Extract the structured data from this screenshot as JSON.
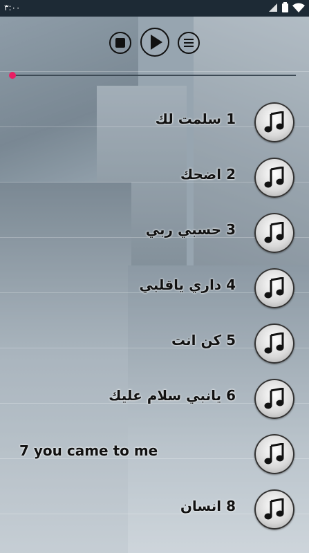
{
  "status_bar": {
    "time": "٣:٠٠"
  },
  "player": {
    "stop_icon": "stop-icon",
    "play_icon": "play-icon",
    "menu_icon": "menu-icon",
    "progress_fraction": 0.0
  },
  "songs": [
    {
      "label": "1 سلمت لك",
      "icon": "music-note-icon"
    },
    {
      "label": "2 اضحك",
      "icon": "music-note-icon"
    },
    {
      "label": "3 حسبي ربي",
      "icon": "music-note-icon"
    },
    {
      "label": "4 داري ياقلبي",
      "icon": "music-note-icon"
    },
    {
      "label": "5 كن انت",
      "icon": "music-note-icon"
    },
    {
      "label": "6 يانبي سلام عليك",
      "icon": "music-note-icon"
    },
    {
      "label": "7 you came to me",
      "icon": "music-note-icon"
    },
    {
      "label": "8 انسان",
      "icon": "music-note-icon"
    }
  ],
  "colors": {
    "accent": "#e91e63",
    "status_bar": "#1d2a35"
  }
}
